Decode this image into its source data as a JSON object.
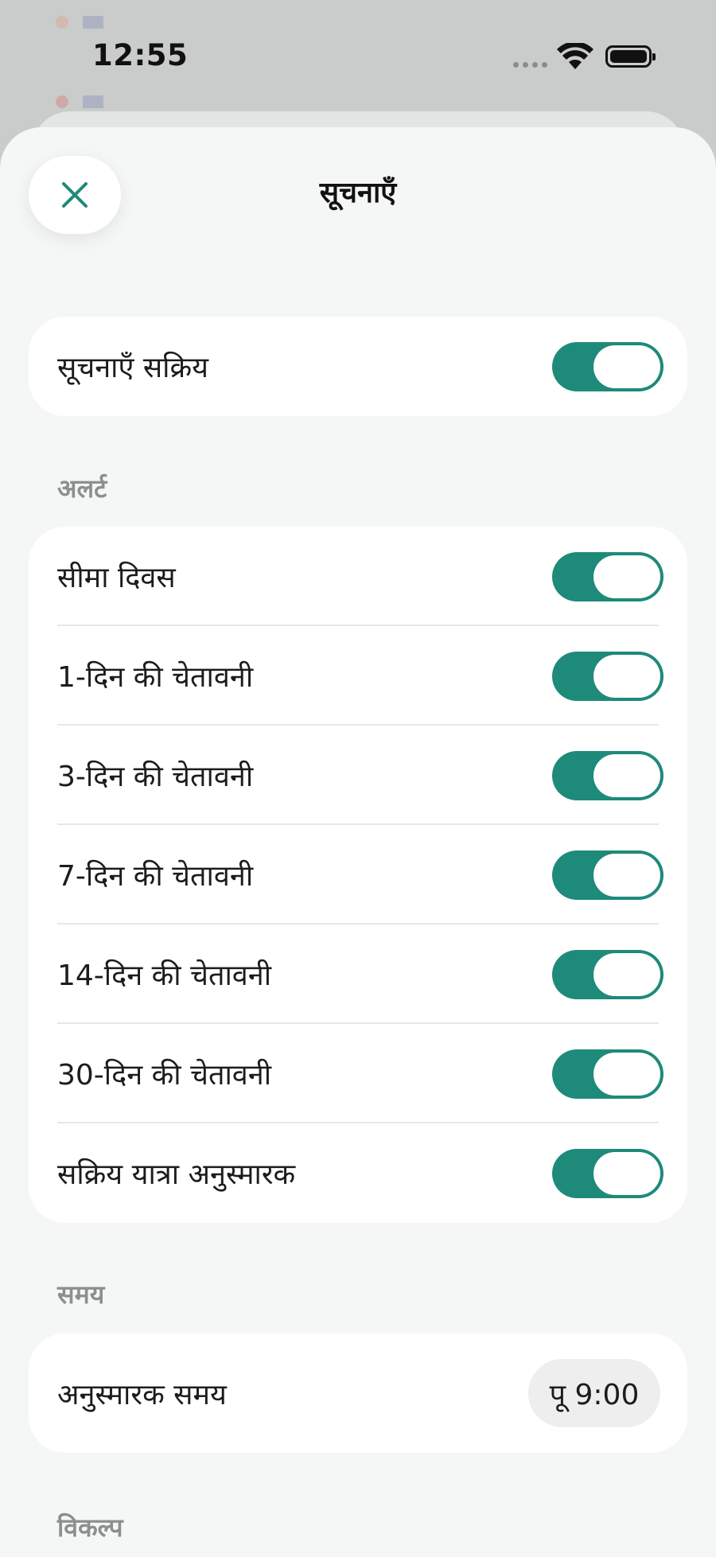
{
  "status_bar": {
    "time": "12:55"
  },
  "background": {
    "rows": [
      {
        "text": "",
        "value": ""
      },
      {
        "text": "",
        "value": ""
      }
    ]
  },
  "sheet": {
    "title": "सूचनाएँ",
    "master": {
      "label": "सूचनाएँ सक्रिय",
      "on": true
    },
    "alerts_section": {
      "label": "अलर्ट",
      "items": [
        {
          "label": "सीमा दिवस",
          "on": true
        },
        {
          "label": "1-दिन की चेतावनी",
          "on": true
        },
        {
          "label": "3-दिन की चेतावनी",
          "on": true
        },
        {
          "label": "7-दिन की चेतावनी",
          "on": true
        },
        {
          "label": "14-दिन की चेतावनी",
          "on": true
        },
        {
          "label": "30-दिन की चेतावनी",
          "on": true
        },
        {
          "label": "सक्रिय यात्रा अनुस्मारक",
          "on": true
        }
      ]
    },
    "time_section": {
      "label": "समय",
      "reminder_label": "अनुस्मारक समय",
      "reminder_value": "पू 9:00"
    },
    "options_section": {
      "label": "विकल्प"
    }
  },
  "colors": {
    "accent": "#1e8a7a",
    "sheet_bg": "#f5f7f6",
    "section_label": "#8d8f8f"
  }
}
